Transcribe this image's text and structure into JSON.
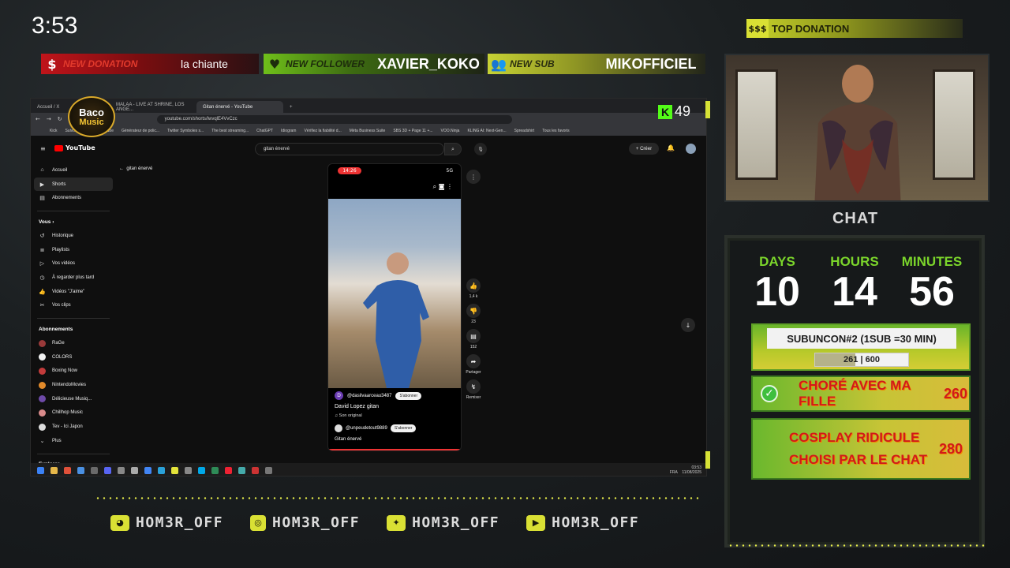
{
  "clock": "3:53",
  "alerts": {
    "donation": {
      "tag": "NEW DONATION",
      "value": "la chiante",
      "icon": "dollar-icon"
    },
    "follower": {
      "tag": "NEW FOLLOWER",
      "value": "XAVIER_KOKO",
      "icon": "heart-icon"
    },
    "sub": {
      "tag": "NEW SUB",
      "value": "MIKOFFICIEL",
      "icon": "users-icon"
    }
  },
  "top_donation": {
    "icon_text": "$$$",
    "label": "TOP DONATION"
  },
  "chat_title": "CHAT",
  "timer": {
    "days_label": "DAYS",
    "days": "10",
    "hours_label": "HOURS",
    "hours": "14",
    "minutes_label": "MINUTES",
    "minutes": "56"
  },
  "goal": {
    "label": "SUBUNCON#2 (1SUB =30 MIN)",
    "current": "261",
    "separator": "|",
    "target": "600",
    "progress_fraction": 0.435
  },
  "challenges": [
    {
      "text": "CHORÉ AVEC MA FILLE",
      "value": "260",
      "done": true
    },
    {
      "text_line1": "COSPLAY RIDICULE",
      "text_line2": "CHOISI PAR LE CHAT",
      "value": "280",
      "done": false
    }
  ],
  "overlay_logo": {
    "line1": "Baco",
    "line2": "Music"
  },
  "kick": {
    "logo": "K",
    "viewers": "49"
  },
  "browser": {
    "tabs": [
      "Accueil / X",
      "MALAA - LIVE AT SHRINE, LOS ANGE...",
      "Gitan énervé - YouTube"
    ],
    "new_tab": "+",
    "url": "youtube.com/shorts/lwvqlE4VvCzc",
    "bookmarks": [
      "Kick",
      "Suivis - Twitch",
      "YouTube",
      "Générateur de polic...",
      "Twitter Symboles s...",
      "The best streaming...",
      "ChatGPT",
      "Idiogram",
      "Vérifiez la fiabilité d...",
      "Méta Business Suite",
      "SBS 3D + Page 11 +...",
      "VOO.Ninja",
      "KLING AI: Next-Gen...",
      "Spreadshirt",
      "Tous les favoris"
    ]
  },
  "youtube": {
    "brand": "YouTube",
    "search_value": "gitan énervé",
    "create_label": "Créer",
    "breadcrumb": "gitan énervé",
    "nav": [
      {
        "label": "Accueil",
        "icon": "home-icon"
      },
      {
        "label": "Shorts",
        "icon": "shorts-icon"
      },
      {
        "label": "Abonnements",
        "icon": "subscriptions-icon"
      }
    ],
    "you_header": "Vous",
    "you_items": [
      {
        "label": "Historique",
        "icon": "history-icon"
      },
      {
        "label": "Playlists",
        "icon": "playlist-icon"
      },
      {
        "label": "Vos vidéos",
        "icon": "video-icon"
      },
      {
        "label": "À regarder plus tard",
        "icon": "clock-icon"
      },
      {
        "label": "Vidéos \"J'aime\"",
        "icon": "thumbs-up-icon"
      },
      {
        "label": "Vos clips",
        "icon": "scissors-icon"
      }
    ],
    "subs_header": "Abonnements",
    "subs": [
      {
        "label": "RaGe",
        "color": "#9a3a3a"
      },
      {
        "label": "COLORS",
        "color": "#f2f2f2"
      },
      {
        "label": "Boxing Now",
        "color": "#c23b3b"
      },
      {
        "label": "NintendoMovies",
        "color": "#e28a2a"
      },
      {
        "label": "Délicieuse Musiq...",
        "color": "#6e4aa8"
      },
      {
        "label": "Chillhop Music",
        "color": "#d98a8a"
      },
      {
        "label": "Tev - Ici Japon",
        "color": "#dcdcdc"
      },
      {
        "label": "Plus",
        "color": ""
      }
    ],
    "explore": "Explorer",
    "short": {
      "time": "14:26",
      "signal": "5G",
      "handle": "@dasilvaarceau3487",
      "subscribe": "S'abonner",
      "title": "David Lopez gitan",
      "sound": "Son original",
      "overlay_handle": "@unpeudetout9889",
      "overlay_sub": "S'abonner",
      "caption": "Gitan énervé",
      "avatar_letter": "D"
    },
    "actions": [
      {
        "icon": "thumbs-up-icon",
        "label": "1,4 k"
      },
      {
        "icon": "thumbs-down-icon",
        "label": "23"
      },
      {
        "icon": "comment-icon",
        "label": "152"
      },
      {
        "icon": "share-icon",
        "label": "Partager"
      },
      {
        "icon": "remix-icon",
        "label": "Remixer"
      }
    ]
  },
  "taskbar": {
    "lang": "FRA",
    "time": "03:53",
    "date": "11/08/2025"
  },
  "socials": [
    {
      "icon": "discord-icon",
      "handle": "HOM3R_OFF"
    },
    {
      "icon": "instagram-icon",
      "handle": "HOM3R_OFF"
    },
    {
      "icon": "twitter-icon",
      "handle": "HOM3R_OFF"
    },
    {
      "icon": "youtube-icon",
      "handle": "HOM3R_OFF"
    }
  ]
}
